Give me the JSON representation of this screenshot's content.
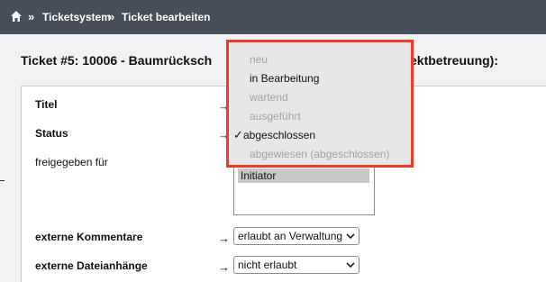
{
  "breadcrumb": {
    "items": [
      "Ticketsystem",
      "Ticket bearbeiten"
    ],
    "separator": "»"
  },
  "page": {
    "heading_left": "Ticket #5: 10006 - Baumrücksch",
    "heading_right": "ektbetreuung):"
  },
  "form": {
    "title_label": "Titel",
    "status_label": "Status",
    "released_label": "freigegeben für",
    "released_options": [
      "Initiator"
    ],
    "comments_label": "externe Kommentare",
    "comments_value": "erlaubt an Verwaltung",
    "attachments_label": "externe Dateianhänge",
    "attachments_value": "nicht erlaubt",
    "arrow": "→"
  },
  "status_dropdown": {
    "selected": "abgeschlossen",
    "options": [
      {
        "label": "neu",
        "enabled": false
      },
      {
        "label": "in Bearbeitung",
        "enabled": true
      },
      {
        "label": "wartend",
        "enabled": false
      },
      {
        "label": "ausgeführt",
        "enabled": false
      },
      {
        "label": "abgeschlossen",
        "enabled": true,
        "checked": true
      },
      {
        "label": "abgewiesen (abgeschlossen)",
        "enabled": false
      }
    ],
    "highlight_color": "#f03c24"
  },
  "icons": {
    "home": "home-icon",
    "check": "checkmark-icon",
    "chevron": "chevron-down-icon"
  }
}
